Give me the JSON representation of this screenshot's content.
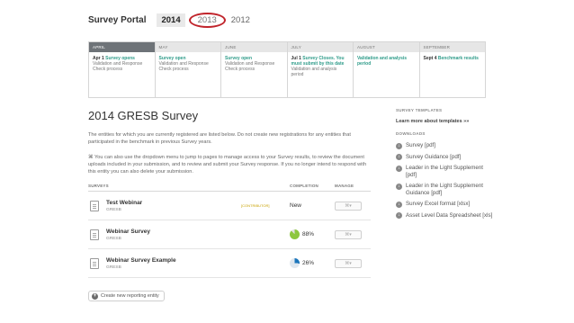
{
  "header": {
    "brand": "Survey Portal",
    "years": [
      "2014",
      "2013",
      "2012"
    ]
  },
  "timeline": [
    {
      "month": "APRIL",
      "date": "Apr 1",
      "event": "Survey opens",
      "desc": "Validation and Response Check process"
    },
    {
      "month": "MAY",
      "date": "",
      "event": "Survey open",
      "desc": "Validation and Response Check process"
    },
    {
      "month": "JUNE",
      "date": "",
      "event": "Survey open",
      "desc": "Validation and Response Check process"
    },
    {
      "month": "JULY",
      "date": "Jul 1",
      "event": "Survey Closes. You must submit by this date",
      "desc": "Validation and analysis period"
    },
    {
      "month": "AUGUST",
      "date": "",
      "event": "Validation and analysis period",
      "desc": ""
    },
    {
      "month": "SEPTEMBER",
      "date": "Sept 4",
      "event": "Benchmark results",
      "desc": ""
    }
  ],
  "main": {
    "title": "2014 GRESB Survey",
    "para1": "The entities for which you are currently registered are listed below. Do not create new registrations for any entities that participated in the benchmark in previous Survey years.",
    "para2": "You can also use the dropdown menu to jump to pages to manage access to your Survey results, to review the document uploads included in your submission, and to review and submit your Survey response. If you no longer intend to respond with this entity you can also delete your submission.",
    "para2_icon": "⌘",
    "col_surveys": "SURVEYS",
    "col_completion": "COMPLETION",
    "col_manage": "MANAGE",
    "rows": [
      {
        "name": "Test Webinar",
        "org": "GRESB",
        "role": "[CONTRIBUTOR]",
        "completion": "New",
        "manage": "⌘▾"
      },
      {
        "name": "Webinar Survey",
        "org": "GRESB",
        "role": "",
        "completion": "88%",
        "manage": "⌘▾"
      },
      {
        "name": "Webinar Survey Example",
        "org": "GRESB",
        "role": "",
        "completion": "26%",
        "manage": "⌘▾"
      }
    ],
    "create_label": "Create new reporting entity"
  },
  "sidebar": {
    "templates_head": "SURVEY TEMPLATES",
    "learn_more": "Learn more about templates »»",
    "downloads_head": "DOWNLOADS",
    "downloads": [
      "Survey [pdf]",
      "Survey Guidance [pdf]",
      "Leader in the Light Supplement [pdf]",
      "Leader in the Light Supplement Guidance [pdf]",
      "Survey Excel format [xlsx]",
      "Asset Level Data Spreadsheet [xls]"
    ]
  },
  "colors": {
    "accent": "#2f9c8a",
    "progress": "#8dc63f",
    "progress2": "#1b75bb",
    "circle": "#c0242b"
  }
}
